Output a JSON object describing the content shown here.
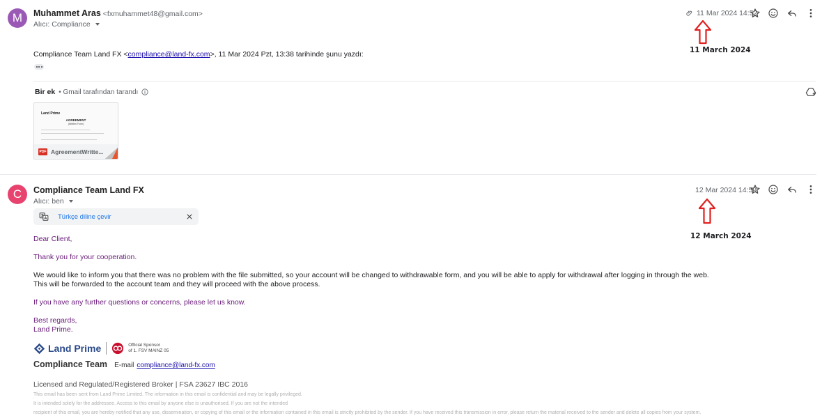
{
  "message1": {
    "avatar_letter": "M",
    "avatar_color": "#9b59b6",
    "sender_name": "Muhammet Aras",
    "sender_email": "<fxmuhammet48@gmail.com>",
    "to_label": "Alıcı: Compliance",
    "date": "11 Mar 2024 14:52",
    "quote_header_prefix": "Compliance Team Land FX <",
    "quote_header_email": "compliance@land-fx.com",
    "quote_header_suffix": ">, 11 Mar 2024 Pzt, 13:38 tarihinde şunu yazdı:",
    "attachment_count": "Bir ek",
    "scan_note": "• Gmail tarafından tarandı",
    "attachment": {
      "filename": "AgreementWritte...",
      "badge": "PDF",
      "preview_brand": "Land Prime",
      "preview_title": "AGREEMENT",
      "preview_subtitle": "(Written Form)"
    }
  },
  "message2": {
    "avatar_letter": "C",
    "avatar_color": "#e8436f",
    "sender_name": "Compliance Team Land FX",
    "to_label": "Alıcı: ben",
    "date": "12 Mar 2024 14:59",
    "translate_label": "Türkçe diline çevir",
    "greeting": "Dear Client,",
    "thanks": "Thank you for your cooperation.",
    "para1_line1": "We would like to inform you that there was no problem with the file submitted, so your account will be changed to withdrawable form, and you will be able to apply for withdrawal after logging in through the web.",
    "para1_line2": "This will be forwarded to the account team and they will proceed with the above process.",
    "questions": "If you have any further questions or concerns, please let us know.",
    "regards": "Best regards,",
    "sign": "Land Prime.",
    "logo_text": "Land Prime",
    "sponsor_line1": "Official Sponsor",
    "sponsor_line2": "of 1. FSV MAINZ 05",
    "team_label": "Compliance Team",
    "email_label": "E-mail",
    "email_link": "compliance@land-fx.com",
    "licensed": "Licensed and Regulated/Registered Broker | FSA 23627 IBC 2016",
    "fine1": "This email has been sent from Land Prime Limited. The information in this email is confidential and may be legally privileged.",
    "fine2": "It is intended solely for the addressee. Access to this email by anyone else is unauthorised. If you are not the intended",
    "fine3": "recipient of this email, you are hereby notified that any use, dissemination, or copying of this email or the information contained in this email is strictly prohibited by the sender. If you have received this transmission in error, please return the material received to the sender and delete all copies from your system."
  },
  "annotations": {
    "date1": "11 March 2024",
    "date2": "12 March 2024",
    "arrow_color": "#e02020"
  }
}
